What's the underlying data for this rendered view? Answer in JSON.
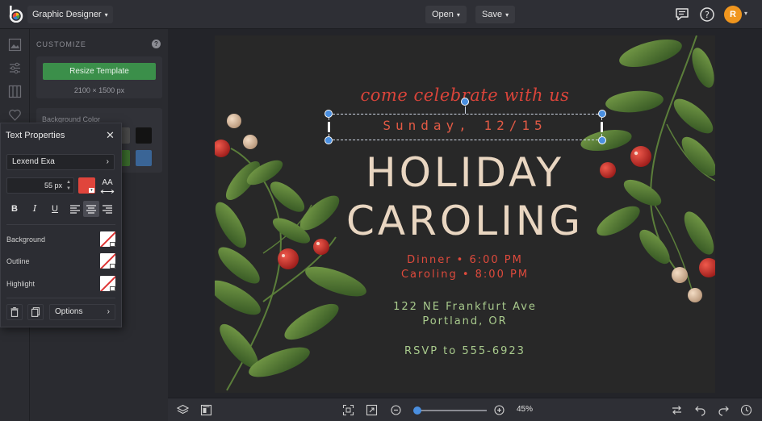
{
  "app": {
    "menu_label": "Graphic Designer"
  },
  "toolbar": {
    "open_label": "Open",
    "save_label": "Save",
    "avatar_initial": "R"
  },
  "customize": {
    "title": "CUSTOMIZE",
    "resize_label": "Resize Template",
    "dimensions": "2100 × 1500 px",
    "bg_color_label": "Background Color"
  },
  "text_properties": {
    "title": "Text Properties",
    "font": "Lexend Exa",
    "size": "55 px",
    "text_color": "#e0453c",
    "bold": "B",
    "italic": "I",
    "underline": "U",
    "case_label": "AA",
    "background_label": "Background",
    "outline_label": "Outline",
    "highlight_label": "Highlight",
    "options_label": "Options"
  },
  "card": {
    "script_line": "come celebrate with us",
    "date_line": "Sunday, 12/15",
    "title_line1": "HOLIDAY",
    "title_line2": "CAROLING",
    "dinner": "Dinner • 6:00 PM",
    "caroling_time": "Caroling • 8:00 PM",
    "address1": "122 NE Frankfurt Ave",
    "address2": "Portland, OR",
    "rsvp": "RSVP to 555-6923"
  },
  "zoom": {
    "label": "45%",
    "value": 45
  },
  "colors": {
    "accent_green": "#3b8f4a",
    "selection_blue": "#4a8fe0",
    "berry_red": "#c9302c",
    "leaf_green": "#5c8a3a",
    "cream": "#e9d6c1"
  }
}
